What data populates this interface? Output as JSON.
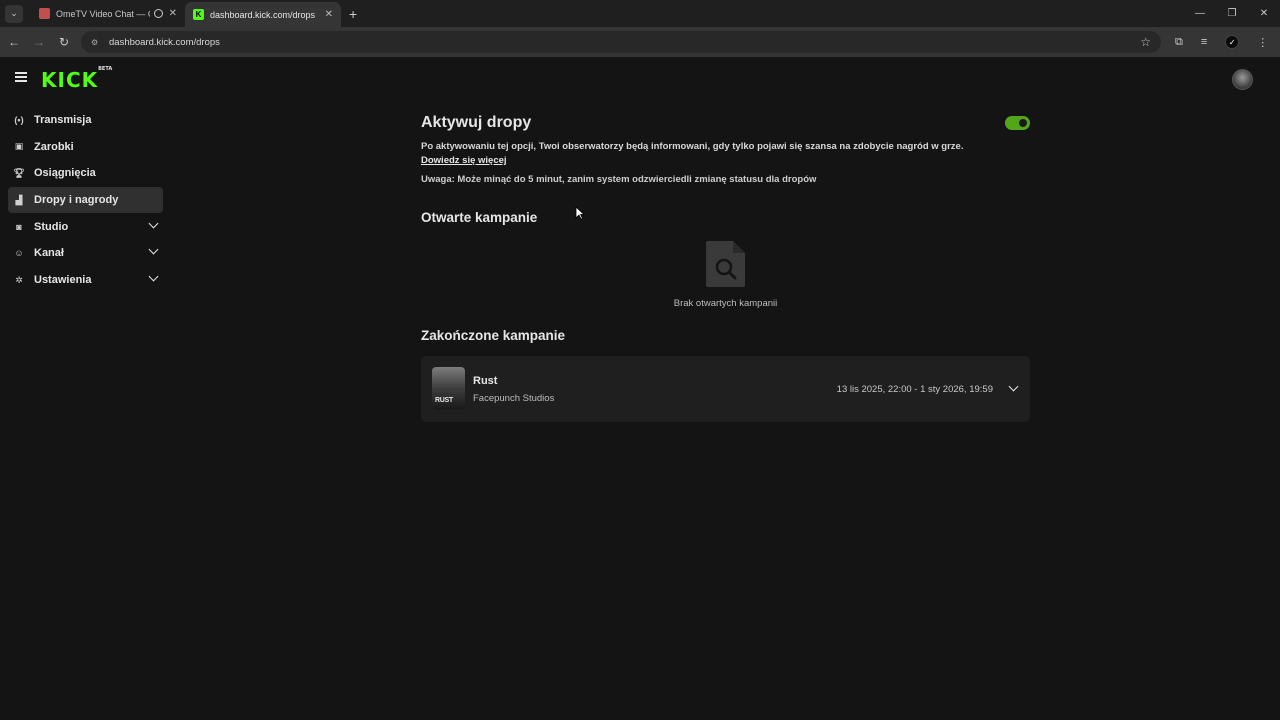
{
  "browser": {
    "tabs": [
      {
        "title": "OmeTV Video Chat — Ome",
        "close": "✕"
      },
      {
        "title": "dashboard.kick.com/drops",
        "close": "✕"
      }
    ],
    "new_tab": "+",
    "url": "dashboard.kick.com/drops"
  },
  "app": {
    "logo": "KICK",
    "logo_badge": "BETA"
  },
  "sidebar": {
    "items": [
      {
        "label": "Transmisja",
        "icon": "broadcast-icon"
      },
      {
        "label": "Zarobki",
        "icon": "earnings-icon"
      },
      {
        "label": "Osiągnięcia",
        "icon": "trophy-icon"
      },
      {
        "label": "Dropy i nagrody",
        "icon": "drops-icon",
        "active": true
      },
      {
        "label": "Studio",
        "icon": "studio-icon",
        "expandable": true
      },
      {
        "label": "Kanał",
        "icon": "channel-icon",
        "expandable": true
      },
      {
        "label": "Ustawienia",
        "icon": "settings-icon",
        "expandable": true
      }
    ]
  },
  "main": {
    "title": "Aktywuj dropy",
    "toggle_on": true,
    "description": "Po aktywowaniu tej opcji, Twoi obserwatorzy będą informowani, gdy tylko pojawi się szansa na zdobycie nagród w grze.",
    "learn_more": "Dowiedz się więcej",
    "note": "Uwaga: Może minąć do 5 minut, zanim system odzwierciedli zmianę statusu dla dropów",
    "open_campaigns": {
      "heading": "Otwarte kampanie",
      "empty_text": "Brak otwartych kampanii"
    },
    "closed_campaigns": {
      "heading": "Zakończone kampanie",
      "items": [
        {
          "title": "Rust",
          "publisher": "Facepunch Studios",
          "dates": "13 lis 2025, 22:00 - 1 sty 2026, 19:59",
          "thumb_text": "RUST"
        }
      ]
    }
  },
  "colors": {
    "accent": "#53fc18",
    "toggle": "#53a61a",
    "background": "#141414",
    "card": "#1f1f1f"
  }
}
